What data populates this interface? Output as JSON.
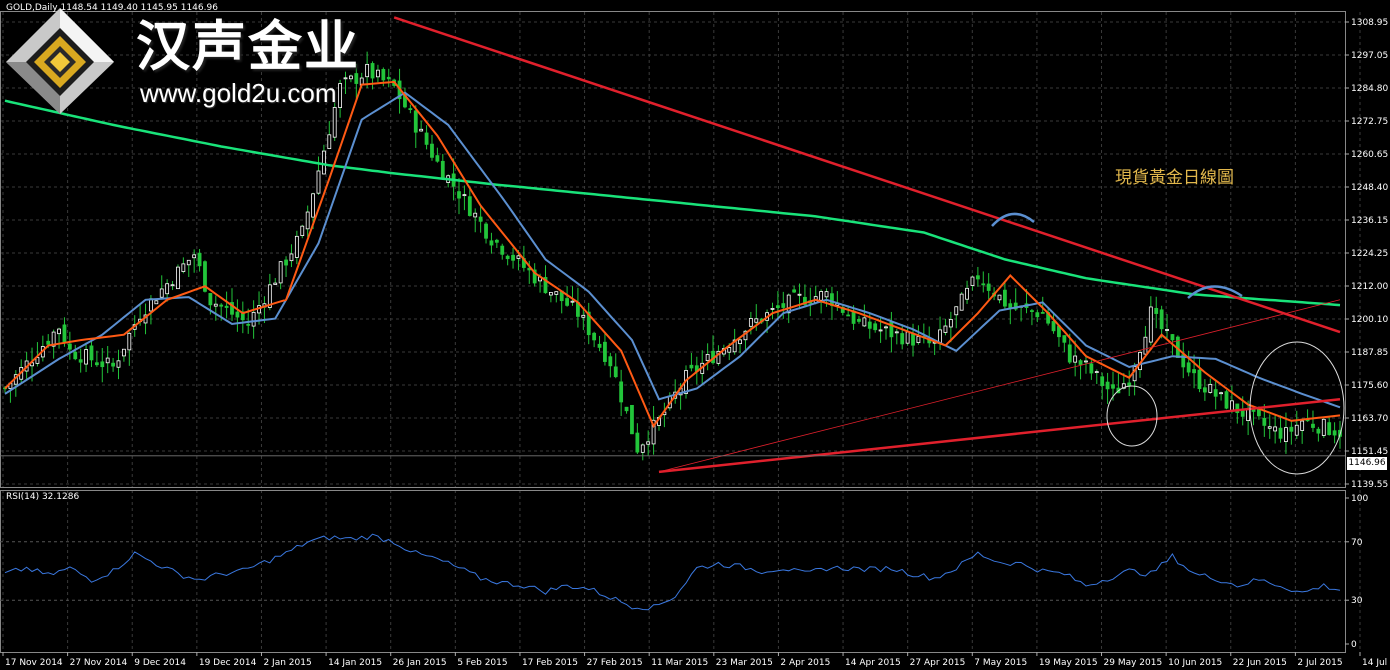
{
  "window": {
    "symbol_header": "GOLD,Daily  1148.54 1149.40 1145.95 1146.96"
  },
  "brand": {
    "name_cn": "汉声金业",
    "url": "www.gold2u.com"
  },
  "annotation": "現貨黃金日線圖",
  "current_price_tag": "1146.96",
  "rsi_label": "RSI(14) 32.1286",
  "colors": {
    "background": "#000000",
    "grid": "#3a3a3a",
    "candle_up": "#ffffff",
    "candle_down": "#22c53a",
    "ma_fast": "#ff5a14",
    "ma_mid": "#5b8fd0",
    "ma_slow": "#19e37a",
    "trendline": "#e0202c",
    "rsi_line": "#3a78e0"
  },
  "chart_data": [
    {
      "type": "candlestick",
      "title": "現貨黃金日線圖",
      "ylim": [
        1135.0,
        1312.0
      ],
      "y_ticks": [
        "1308.95",
        "1297.05",
        "1284.80",
        "1272.75",
        "1260.65",
        "1248.40",
        "1236.15",
        "1224.25",
        "1212.00",
        "1200.10",
        "1187.85",
        "1175.60",
        "1163.70",
        "1151.45",
        "1139.55"
      ],
      "x_ticks": [
        "17 Nov 2014",
        "27 Nov 2014",
        "9 Dec 2014",
        "19 Dec 2014",
        "2 Jan 2015",
        "14 Jan 2015",
        "26 Jan 2015",
        "5 Feb 2015",
        "17 Feb 2015",
        "27 Feb 2015",
        "11 Mar 2015",
        "23 Mar 2015",
        "2 Apr 2015",
        "14 Apr 2015",
        "27 Apr 2015",
        "7 May 2015",
        "19 May 2015",
        "29 May 2015",
        "10 Jun 2015",
        "22 Jun 2015",
        "2 Jul 2015",
        "14 Jul 2015"
      ],
      "close_path": [
        [
          0,
          1172
        ],
        [
          10,
          1195
        ],
        [
          12,
          1186
        ],
        [
          20,
          1180
        ],
        [
          25,
          1200
        ],
        [
          35,
          1222
        ],
        [
          38,
          1205
        ],
        [
          45,
          1196
        ],
        [
          55,
          1230
        ],
        [
          62,
          1284
        ],
        [
          67,
          1290
        ],
        [
          72,
          1284
        ],
        [
          80,
          1256
        ],
        [
          90,
          1228
        ],
        [
          100,
          1210
        ],
        [
          106,
          1200
        ],
        [
          112,
          1182
        ],
        [
          117,
          1150
        ],
        [
          121,
          1160
        ],
        [
          126,
          1176
        ],
        [
          132,
          1186
        ],
        [
          138,
          1196
        ],
        [
          146,
          1205
        ],
        [
          152,
          1207
        ],
        [
          158,
          1196
        ],
        [
          165,
          1192
        ],
        [
          172,
          1188
        ],
        [
          180,
          1214
        ],
        [
          186,
          1202
        ],
        [
          192,
          1200
        ],
        [
          197,
          1184
        ],
        [
          200,
          1180
        ],
        [
          205,
          1170
        ],
        [
          208,
          1176
        ],
        [
          212,
          1200
        ],
        [
          215,
          1191
        ],
        [
          220,
          1176
        ],
        [
          225,
          1168
        ],
        [
          229,
          1163
        ],
        [
          234,
          1157
        ],
        [
          237,
          1155
        ],
        [
          240,
          1160
        ],
        [
          247,
          1156
        ]
      ],
      "ma_fast_path": [
        [
          0,
          1172
        ],
        [
          8,
          1188
        ],
        [
          14,
          1190
        ],
        [
          22,
          1192
        ],
        [
          30,
          1205
        ],
        [
          37,
          1210
        ],
        [
          44,
          1200
        ],
        [
          52,
          1205
        ],
        [
          60,
          1250
        ],
        [
          66,
          1285
        ],
        [
          72,
          1286
        ],
        [
          80,
          1266
        ],
        [
          88,
          1240
        ],
        [
          98,
          1215
        ],
        [
          106,
          1204
        ],
        [
          114,
          1186
        ],
        [
          120,
          1158
        ],
        [
          126,
          1175
        ],
        [
          134,
          1188
        ],
        [
          142,
          1200
        ],
        [
          150,
          1205
        ],
        [
          158,
          1200
        ],
        [
          166,
          1194
        ],
        [
          174,
          1188
        ],
        [
          180,
          1200
        ],
        [
          186,
          1214
        ],
        [
          193,
          1200
        ],
        [
          200,
          1184
        ],
        [
          208,
          1176
        ],
        [
          214,
          1192
        ],
        [
          222,
          1178
        ],
        [
          230,
          1166
        ],
        [
          238,
          1160
        ],
        [
          247,
          1162
        ]
      ],
      "ma_mid_path": [
        [
          0,
          1170
        ],
        [
          10,
          1183
        ],
        [
          18,
          1192
        ],
        [
          26,
          1205
        ],
        [
          34,
          1206
        ],
        [
          42,
          1196
        ],
        [
          50,
          1198
        ],
        [
          58,
          1226
        ],
        [
          66,
          1272
        ],
        [
          74,
          1282
        ],
        [
          82,
          1270
        ],
        [
          92,
          1243
        ],
        [
          100,
          1220
        ],
        [
          108,
          1208
        ],
        [
          116,
          1190
        ],
        [
          121,
          1168
        ],
        [
          128,
          1172
        ],
        [
          136,
          1184
        ],
        [
          144,
          1200
        ],
        [
          152,
          1205
        ],
        [
          160,
          1200
        ],
        [
          168,
          1194
        ],
        [
          176,
          1186
        ],
        [
          184,
          1201
        ],
        [
          192,
          1204
        ],
        [
          200,
          1188
        ],
        [
          208,
          1180
        ],
        [
          216,
          1184
        ],
        [
          224,
          1183
        ],
        [
          232,
          1176
        ],
        [
          240,
          1170
        ],
        [
          247,
          1165
        ]
      ],
      "ma_slow_path": [
        [
          0,
          1279
        ],
        [
          20,
          1270
        ],
        [
          40,
          1262
        ],
        [
          60,
          1255
        ],
        [
          72,
          1252
        ],
        [
          90,
          1248
        ],
        [
          110,
          1244
        ],
        [
          130,
          1240
        ],
        [
          150,
          1236
        ],
        [
          170,
          1230
        ],
        [
          185,
          1220
        ],
        [
          200,
          1213
        ],
        [
          220,
          1207
        ],
        [
          247,
          1203
        ]
      ],
      "trendlines": [
        {
          "from": [
            72,
            1310
          ],
          "to": [
            247,
            1193
          ]
        },
        {
          "from": [
            121,
            1141
          ],
          "to": [
            247,
            1168
          ]
        },
        {
          "from": [
            121,
            1141
          ],
          "to": [
            247,
            1205
          ]
        }
      ]
    },
    {
      "type": "line",
      "title": "RSI(14) 32.1286",
      "ylim": [
        0,
        100
      ],
      "y_ticks": [
        "100",
        "70",
        "30",
        "0"
      ],
      "series": [
        {
          "name": "RSI(14)",
          "path": [
            [
              0,
              48
            ],
            [
              4,
              52
            ],
            [
              8,
              47
            ],
            [
              12,
              52
            ],
            [
              16,
              44
            ],
            [
              20,
              50
            ],
            [
              24,
              62
            ],
            [
              28,
              55
            ],
            [
              32,
              48
            ],
            [
              36,
              44
            ],
            [
              40,
              48
            ],
            [
              44,
              50
            ],
            [
              48,
              56
            ],
            [
              52,
              62
            ],
            [
              56,
              70
            ],
            [
              60,
              73
            ],
            [
              64,
              72
            ],
            [
              68,
              74
            ],
            [
              72,
              70
            ],
            [
              76,
              62
            ],
            [
              80,
              58
            ],
            [
              84,
              52
            ],
            [
              88,
              45
            ],
            [
              92,
              42
            ],
            [
              96,
              40
            ],
            [
              100,
              36
            ],
            [
              104,
              40
            ],
            [
              108,
              38
            ],
            [
              112,
              32
            ],
            [
              116,
              26
            ],
            [
              120,
              25
            ],
            [
              124,
              33
            ],
            [
              128,
              52
            ],
            [
              132,
              55
            ],
            [
              136,
              53
            ],
            [
              140,
              50
            ],
            [
              144,
              52
            ],
            [
              148,
              48
            ],
            [
              152,
              52
            ],
            [
              156,
              52
            ],
            [
              160,
              51
            ],
            [
              164,
              52
            ],
            [
              168,
              48
            ],
            [
              172,
              45
            ],
            [
              176,
              52
            ],
            [
              180,
              62
            ],
            [
              184,
              56
            ],
            [
              188,
              55
            ],
            [
              192,
              50
            ],
            [
              196,
              48
            ],
            [
              200,
              40
            ],
            [
              204,
              45
            ],
            [
              208,
              50
            ],
            [
              212,
              48
            ],
            [
              216,
              60
            ],
            [
              220,
              48
            ],
            [
              224,
              45
            ],
            [
              228,
              40
            ],
            [
              232,
              44
            ],
            [
              236,
              40
            ],
            [
              240,
              35
            ],
            [
              244,
              40
            ],
            [
              247,
              37
            ]
          ]
        }
      ]
    }
  ]
}
